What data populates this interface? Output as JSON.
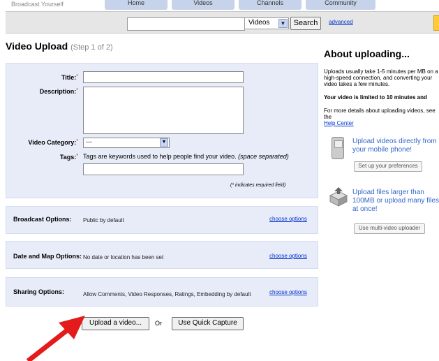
{
  "top": {
    "brand": "Broadcast Yourself",
    "tabs": [
      "Home",
      "Videos",
      "Channels",
      "Community"
    ]
  },
  "search": {
    "query": "",
    "category": "Videos",
    "button": "Search",
    "advanced": "advanced"
  },
  "page": {
    "title": "Video Upload",
    "step": "(Step 1 of 2)"
  },
  "form": {
    "title_label": "Title:",
    "description_label": "Description:",
    "category_label": "Video Category:",
    "category_value": "---",
    "tags_label": "Tags:",
    "tags_help": "Tags are keywords used to help people find your video.",
    "tags_help_italic": "(space separated)",
    "required_note": "(* indicates required field)",
    "required_mark": "*"
  },
  "options": [
    {
      "label": "Broadcast Options:",
      "value": "Public by default",
      "link": "choose options"
    },
    {
      "label": "Date and Map Options:",
      "value": "No date or location has been set",
      "link": "choose options"
    },
    {
      "label": "Sharing Options:",
      "value": "Allow Comments, Video Responses, Ratings, Embedding by default",
      "link": "choose options"
    }
  ],
  "actions": {
    "upload": "Upload a video...",
    "or": "Or",
    "quick_capture": "Use Quick Capture"
  },
  "about": {
    "title": "About uploading...",
    "p1": "Uploads usually take 1-5 minutes per MB on a high-speed connection, and converting your video takes a few minutes.",
    "p2": "Your video is limited to 10 minutes and",
    "p3": "For more details about uploading videos, see the",
    "help_link": "Help Center",
    "mobile_text": "Upload videos directly from your mobile phone!",
    "mobile_button": "Set up your preferences",
    "large_text": "Upload files larger than 100MB or upload many files at once!",
    "large_button": "Use multi-video uploader"
  },
  "colors": {
    "panel": "#e8ecf9",
    "link": "#0033cc",
    "accent": "#3366cc",
    "arrow": "#e31b1b"
  }
}
